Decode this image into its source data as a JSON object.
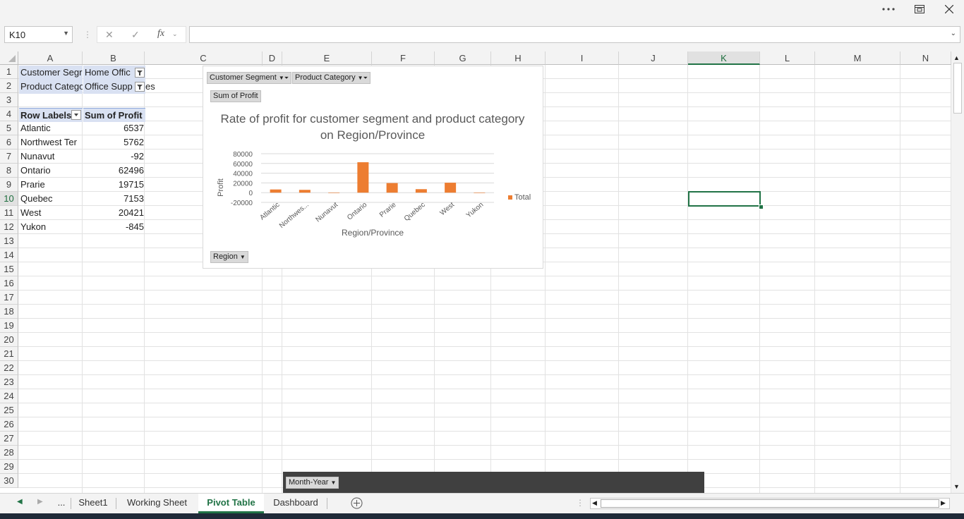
{
  "titlebar": {
    "more_icon": "ellipsis-icon",
    "restore_icon": "restore-icon",
    "close_icon": "close-icon"
  },
  "formula_bar": {
    "name_box": "K10",
    "cancel_symbol": "✕",
    "enter_symbol": "✓",
    "fx_label": "fx",
    "formula_value": ""
  },
  "columns": [
    "A",
    "B",
    "C",
    "D",
    "E",
    "F",
    "G",
    "H",
    "I",
    "J",
    "K",
    "L",
    "M",
    "N"
  ],
  "selected_column": "K",
  "rows": [
    "1",
    "2",
    "3",
    "4",
    "5",
    "6",
    "7",
    "8",
    "9",
    "10",
    "11",
    "12",
    "13",
    "14",
    "15",
    "16",
    "17",
    "18",
    "19",
    "20",
    "21",
    "22",
    "23",
    "24",
    "25",
    "26",
    "27",
    "28",
    "29",
    "30"
  ],
  "selected_row": "10",
  "pivot": {
    "filter1_label": "Customer Segr",
    "filter1_value": "Home Offic",
    "filter2_label": "Product Catego",
    "filter2_value": "Office Supp",
    "filter2_overflow": "es",
    "row_labels_header": "Row Labels",
    "sum_header": "Sum of Profit",
    "rows": [
      {
        "label": "Atlantic",
        "value": "6537"
      },
      {
        "label": "Northwest Ter",
        "value": "5762"
      },
      {
        "label": "Nunavut",
        "value": "-92"
      },
      {
        "label": "Ontario",
        "value": "62496"
      },
      {
        "label": "Prarie",
        "value": "19715"
      },
      {
        "label": "Quebec",
        "value": "7153"
      },
      {
        "label": "West",
        "value": "20421"
      },
      {
        "label": "Yukon",
        "value": "-845"
      }
    ]
  },
  "chart_filters": {
    "segment": "Customer Segment",
    "category": "Product Category",
    "value_field": "Sum of Profit",
    "axis_field": "Region"
  },
  "chart_data": {
    "type": "bar",
    "title": "Rate of profit for customer segment and product category on Region/Province",
    "xlabel": "Region/Province",
    "ylabel": "Profit",
    "categories": [
      "Atlantic",
      "Northwes...",
      "Nunavut",
      "Ontario",
      "Prarie",
      "Quebec",
      "West",
      "Yukon"
    ],
    "series": [
      {
        "name": "Total",
        "values": [
          6537,
          5762,
          -92,
          62496,
          19715,
          7153,
          20421,
          -845
        ]
      }
    ],
    "ylim": [
      -20000,
      80000
    ],
    "yticks": [
      "80000",
      "60000",
      "40000",
      "20000",
      "0",
      "-20000"
    ],
    "grid": true,
    "legend": "right",
    "bar_color": "#ed7d31"
  },
  "slicer": {
    "month_year": "Month-Year"
  },
  "sheet_tabs": {
    "ellipsis": "...",
    "tabs": [
      "Sheet1",
      "Working Sheet",
      "Pivot Table",
      "Dashboard"
    ],
    "active": "Pivot Table"
  },
  "colors": {
    "accent": "#217346",
    "pivot_header": "#d9e1f2",
    "selection": "#217346"
  }
}
